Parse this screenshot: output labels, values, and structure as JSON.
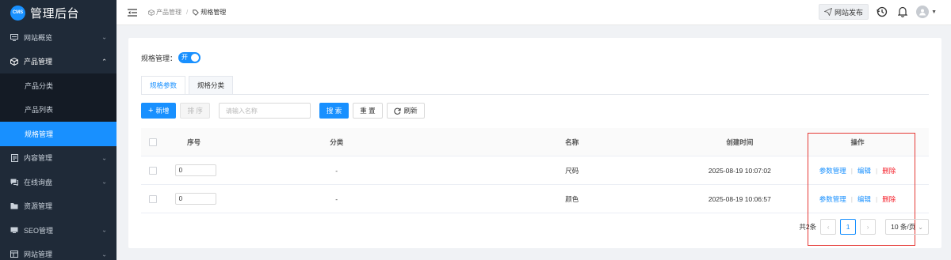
{
  "app": {
    "logo_badge": "CMS",
    "title": "管理后台"
  },
  "sidebar": {
    "items": [
      {
        "label": "网站概览",
        "icon": "monitor-icon"
      },
      {
        "label": "产品管理",
        "icon": "cube-icon"
      },
      {
        "label": "内容管理",
        "icon": "document-icon"
      },
      {
        "label": "在线询盘",
        "icon": "chat-icon"
      },
      {
        "label": "资源管理",
        "icon": "folder-icon"
      },
      {
        "label": "SEO管理",
        "icon": "seo-icon"
      },
      {
        "label": "网站管理",
        "icon": "site-icon"
      }
    ],
    "submenu": [
      {
        "label": "产品分类"
      },
      {
        "label": "产品列表"
      },
      {
        "label": "规格管理"
      }
    ]
  },
  "header": {
    "breadcrumb": [
      "产品管理",
      "规格管理"
    ],
    "publish_label": "网站发布"
  },
  "spec": {
    "switch_label": "规格管理：",
    "switch_text": "开",
    "tabs": [
      "规格参数",
      "规格分类"
    ],
    "buttons": {
      "add": "新增",
      "sort": "排 序",
      "search": "搜 索",
      "reset": "重 置",
      "refresh": "刷新"
    },
    "search_placeholder": "请输入名称"
  },
  "table": {
    "headers": {
      "no": "序号",
      "category": "分类",
      "name": "名称",
      "created": "创建时间",
      "actions": "操作"
    },
    "rows": [
      {
        "sort": "0",
        "category": "-",
        "name": "尺码",
        "created": "2025-08-19 10:07:02"
      },
      {
        "sort": "0",
        "category": "-",
        "name": "颜色",
        "created": "2025-08-19 10:06:57"
      }
    ],
    "actions": {
      "params": "参数管理",
      "edit": "编辑",
      "delete": "删除",
      "sep": "|"
    }
  },
  "pagination": {
    "total": "共2条",
    "current": "1",
    "prev": "‹",
    "next": "›",
    "page_size": "10 条/页"
  },
  "colors": {
    "primary": "#1890ff",
    "danger": "#f5222d",
    "sidebar_bg": "#1f2a38",
    "highlight": "#e53935"
  }
}
